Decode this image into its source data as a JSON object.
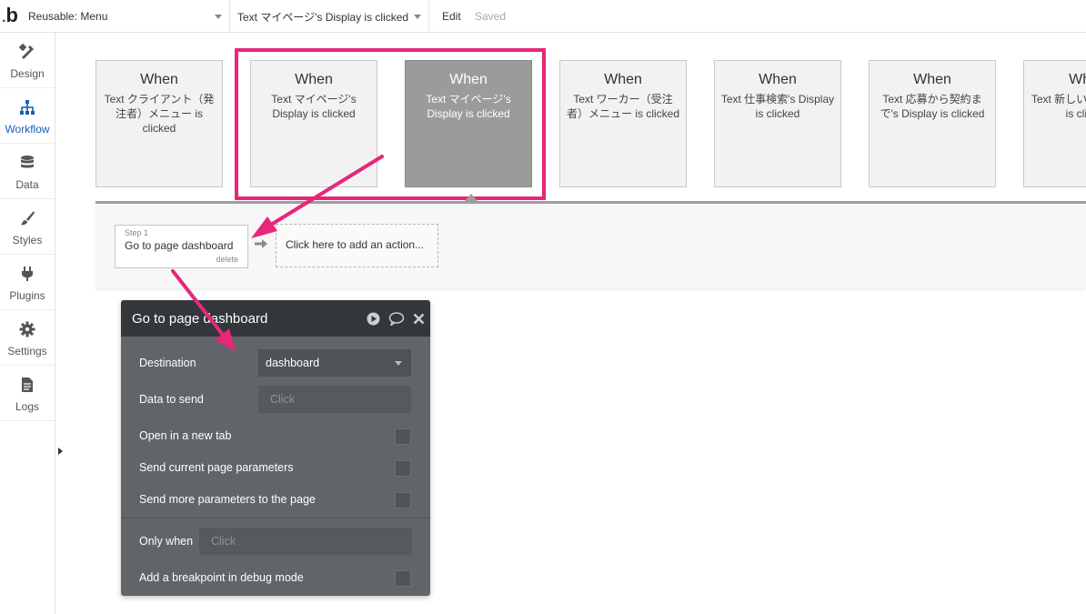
{
  "topbar": {
    "logo": "b",
    "page_selector": "Reusable: Menu",
    "event_selector": "Text マイページ's Display is clicked",
    "edit": "Edit",
    "saved": "Saved"
  },
  "sidebar": {
    "items": [
      {
        "label": "Design",
        "icon": "design-icon"
      },
      {
        "label": "Workflow",
        "icon": "workflow-icon"
      },
      {
        "label": "Data",
        "icon": "database-icon"
      },
      {
        "label": "Styles",
        "icon": "brush-icon"
      },
      {
        "label": "Plugins",
        "icon": "plug-icon"
      },
      {
        "label": "Settings",
        "icon": "gear-icon"
      },
      {
        "label": "Logs",
        "icon": "document-icon"
      }
    ],
    "active": "Workflow"
  },
  "events": [
    {
      "when": "When",
      "text": "Text クライアント（発注者）メニュー is clicked"
    },
    {
      "when": "When",
      "text": "Text マイページ's Display is clicked"
    },
    {
      "when": "When",
      "text": "Text マイページ's Display is clicked"
    },
    {
      "when": "When",
      "text": "Text ワーカー（受注者）メニュー is clicked"
    },
    {
      "when": "When",
      "text": "Text 仕事検索's Display is clicked"
    },
    {
      "when": "When",
      "text": "Text 応募から契約まで's Display is clicked"
    },
    {
      "when": "When",
      "text": "Text 新しい成's Display is clicked"
    }
  ],
  "step": {
    "number": "Step 1",
    "name": "Go to page dashboard",
    "delete": "delete"
  },
  "add_action": "Click here to add an action...",
  "panel": {
    "title": "Go to page dashboard",
    "destination_label": "Destination",
    "destination_value": "dashboard",
    "data_to_send_label": "Data to send",
    "data_to_send_placeholder": "Click",
    "open_new_tab": "Open in a new tab",
    "send_current_params": "Send current page parameters",
    "send_more_params": "Send more parameters to the page",
    "only_when_label": "Only when",
    "only_when_placeholder": "Click",
    "breakpoint": "Add a breakpoint in debug mode"
  },
  "colors": {
    "highlight": "#e8267a",
    "selected_card": "#9b9b9b",
    "panel_bg": "#616569",
    "panel_header": "#33373b",
    "active_nav": "#1a5fb4"
  }
}
